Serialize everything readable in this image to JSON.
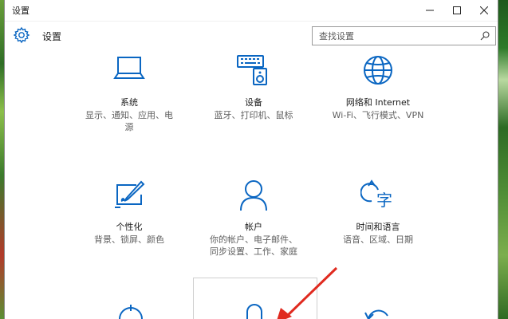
{
  "window": {
    "title": "设置"
  },
  "header": {
    "title": "设置"
  },
  "search": {
    "placeholder": "查找设置"
  },
  "tiles": [
    {
      "name": "系统",
      "desc1": "显示、通知、应用、电",
      "desc2": "源"
    },
    {
      "name": "设备",
      "desc1": "蓝牙、打印机、鼠标",
      "desc2": ""
    },
    {
      "name": "网络和 Internet",
      "desc1": "Wi-Fi、飞行模式、VPN",
      "desc2": ""
    },
    {
      "name": "个性化",
      "desc1": "背景、锁屏、颜色",
      "desc2": ""
    },
    {
      "name": "帐户",
      "desc1": "你的帐户、电子邮件、",
      "desc2": "同步设置、工作、家庭"
    },
    {
      "name": "时间和语言",
      "desc1": "语音、区域、日期",
      "desc2": ""
    }
  ],
  "colors": {
    "accent": "#0a66c2",
    "arrow": "#e02a1f"
  }
}
